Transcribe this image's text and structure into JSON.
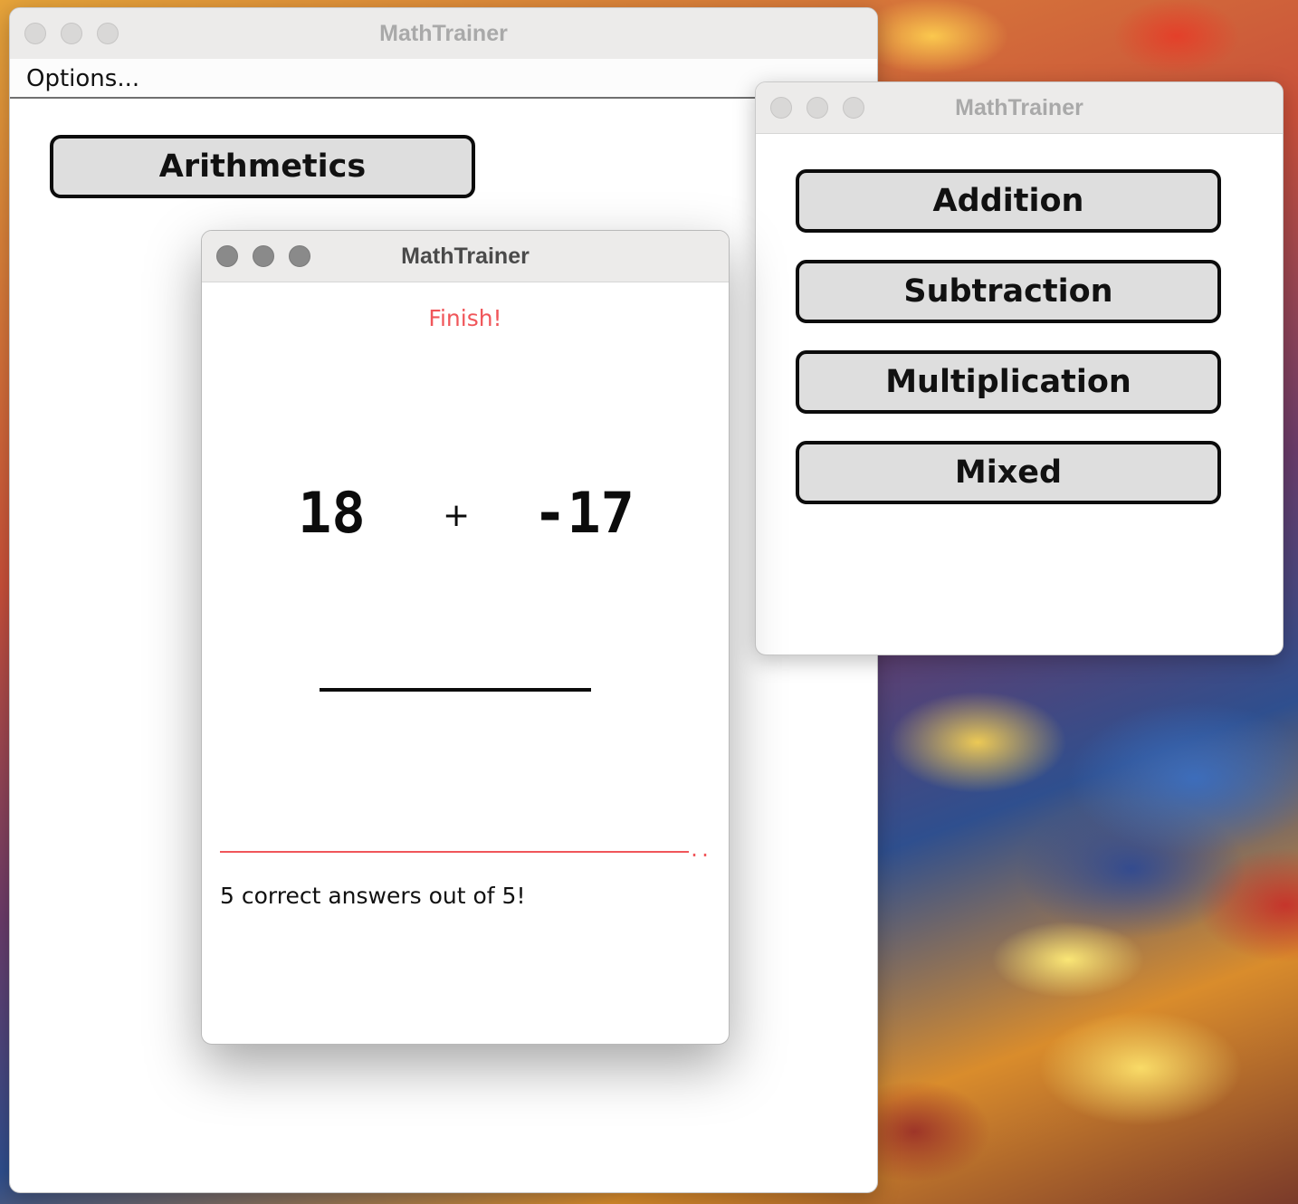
{
  "windows": {
    "main": {
      "title": "MathTrainer",
      "menu": "Options...",
      "arithmetics_button": "Arithmetics"
    },
    "operations": {
      "title": "MathTrainer",
      "buttons": [
        "Addition",
        "Subtraction",
        "Multiplication",
        "Mixed"
      ]
    },
    "quiz": {
      "title": "MathTrainer",
      "status": "Finish!",
      "operand_left": "18",
      "operator": "+",
      "operand_right": "-17",
      "divider_suffix": "...",
      "score_text": "5 correct answers out of 5!"
    }
  },
  "colors": {
    "accent_red": "#f0565a",
    "button_fill": "#dedede",
    "button_border": "#0c0c0c"
  }
}
